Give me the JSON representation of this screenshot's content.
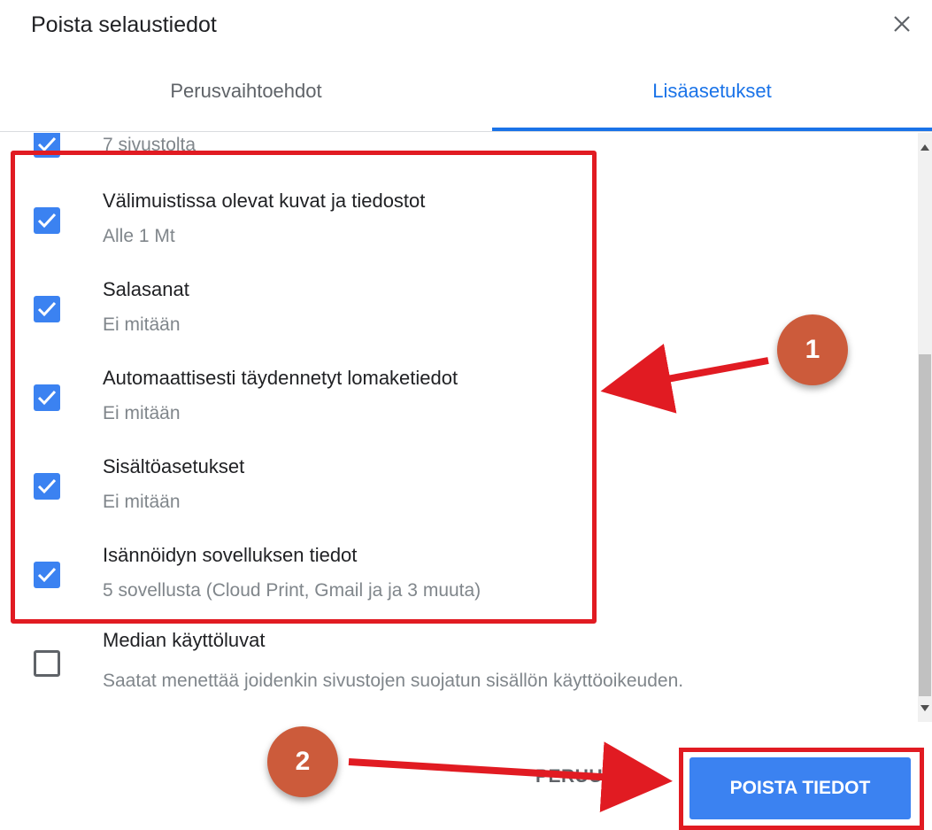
{
  "dialog": {
    "title": "Poista selaustiedot",
    "close_icon": "close-icon"
  },
  "tabs": [
    {
      "label": "Perusvaihtoehdot",
      "active": false
    },
    {
      "label": "Lisäasetukset",
      "active": true
    }
  ],
  "items": [
    {
      "title": "",
      "subtitle": "7 sivustolta",
      "checked": true
    },
    {
      "title": "Välimuistissa olevat kuvat ja tiedostot",
      "subtitle": "Alle 1 Mt",
      "checked": true
    },
    {
      "title": "Salasanat",
      "subtitle": "Ei mitään",
      "checked": true
    },
    {
      "title": "Automaattisesti täydennetyt lomaketiedot",
      "subtitle": "Ei mitään",
      "checked": true
    },
    {
      "title": "Sisältöasetukset",
      "subtitle": "Ei mitään",
      "checked": true
    },
    {
      "title": "Isännöidyn sovelluksen tiedot",
      "subtitle": "5 sovellusta (Cloud Print, Gmail ja ja 3 muuta)",
      "checked": true
    },
    {
      "title": "Median käyttöluvat",
      "subtitle": "Saatat menettää joidenkin sivustojen suojatun sisällön käyttöoikeuden.",
      "checked": false
    }
  ],
  "footer": {
    "cancel_label": "PERUUTA",
    "confirm_label": "POISTA TIEDOT"
  },
  "annotations": {
    "marker1": "1",
    "marker2": "2"
  },
  "colors": {
    "accent": "#1a73e8",
    "checkbox": "#3b82f1",
    "annotation_red": "#e11b22",
    "marker": "#cc5b3b"
  }
}
